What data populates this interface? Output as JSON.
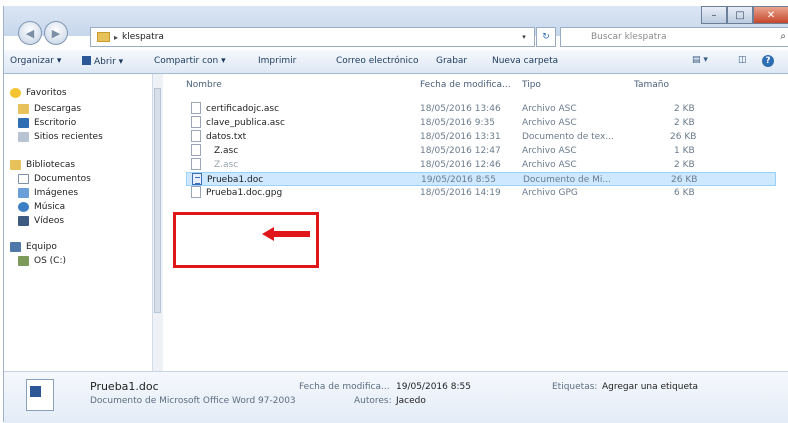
{
  "window": {
    "caption_buttons": [
      "–",
      "□",
      "✕"
    ]
  },
  "address": {
    "arrow": "▸",
    "path": "klespatra",
    "dropdown": "▾",
    "refresh": "↻",
    "search_placeholder": "Buscar klespatra",
    "search_icon": "magnifier-icon"
  },
  "toolbar": {
    "organize": "Organizar ▾",
    "open": "Abrir ▾",
    "share": "Compartir con ▾",
    "print": "Imprimir",
    "email": "Correo electrónico",
    "burn": "Grabar",
    "new_folder": "Nueva carpeta",
    "views": "▤ ▾",
    "preview": "◫",
    "help": "?"
  },
  "nav": {
    "favorites": "Favoritos",
    "downloads": "Descargas",
    "desktop": "Escritorio",
    "recent": "Sitios recientes",
    "libraries": "Bibliotecas",
    "documents": "Documentos",
    "images": "Imágenes",
    "music": "Música",
    "videos": "Vídeos",
    "computer": "Equipo",
    "drive": "OS (C:)"
  },
  "columns": {
    "name": "Nombre",
    "date": "Fecha de modifica...",
    "type": "Tipo",
    "size": "Tamaño"
  },
  "files": [
    {
      "name": "certificadojc.asc",
      "date": "18/05/2016 13:46",
      "type": "Archivo ASC",
      "size": "2 KB"
    },
    {
      "name": "clave_publica.asc",
      "date": "18/05/2016 9:35",
      "type": "Archivo ASC",
      "size": "2 KB"
    },
    {
      "name": "datos.txt",
      "date": "18/05/2016 13:31",
      "type": "Documento de tex...",
      "size": "26 KB"
    },
    {
      "name": "Z.asc",
      "date": "18/05/2016 12:47",
      "type": "Archivo ASC",
      "size": "1 KB"
    },
    {
      "name": "Z.asc",
      "date": "18/05/2016 12:46",
      "type": "Archivo ASC",
      "size": "2 KB"
    },
    {
      "name": "Prueba1.doc",
      "date": "19/05/2016 8:55",
      "type": "Documento de Mi...",
      "size": "26 KB"
    },
    {
      "name": "Prueba1.doc.gpg",
      "date": "18/05/2016 14:19",
      "type": "Archivo GPG",
      "size": "6 KB"
    }
  ],
  "details": {
    "filename": "Prueba1.doc",
    "filetype": "Documento de Microsoft Office Word 97-2003",
    "date_label": "Fecha de modifica...",
    "date_value": "19/05/2016 8:55",
    "author_label": "Autores:",
    "author_value": "Jacedo",
    "tags_label": "Etiquetas:",
    "tags_value": "Agregar una etiqueta"
  },
  "colors": {
    "highlight": "#e0161b",
    "selection": "#cde8ff"
  }
}
